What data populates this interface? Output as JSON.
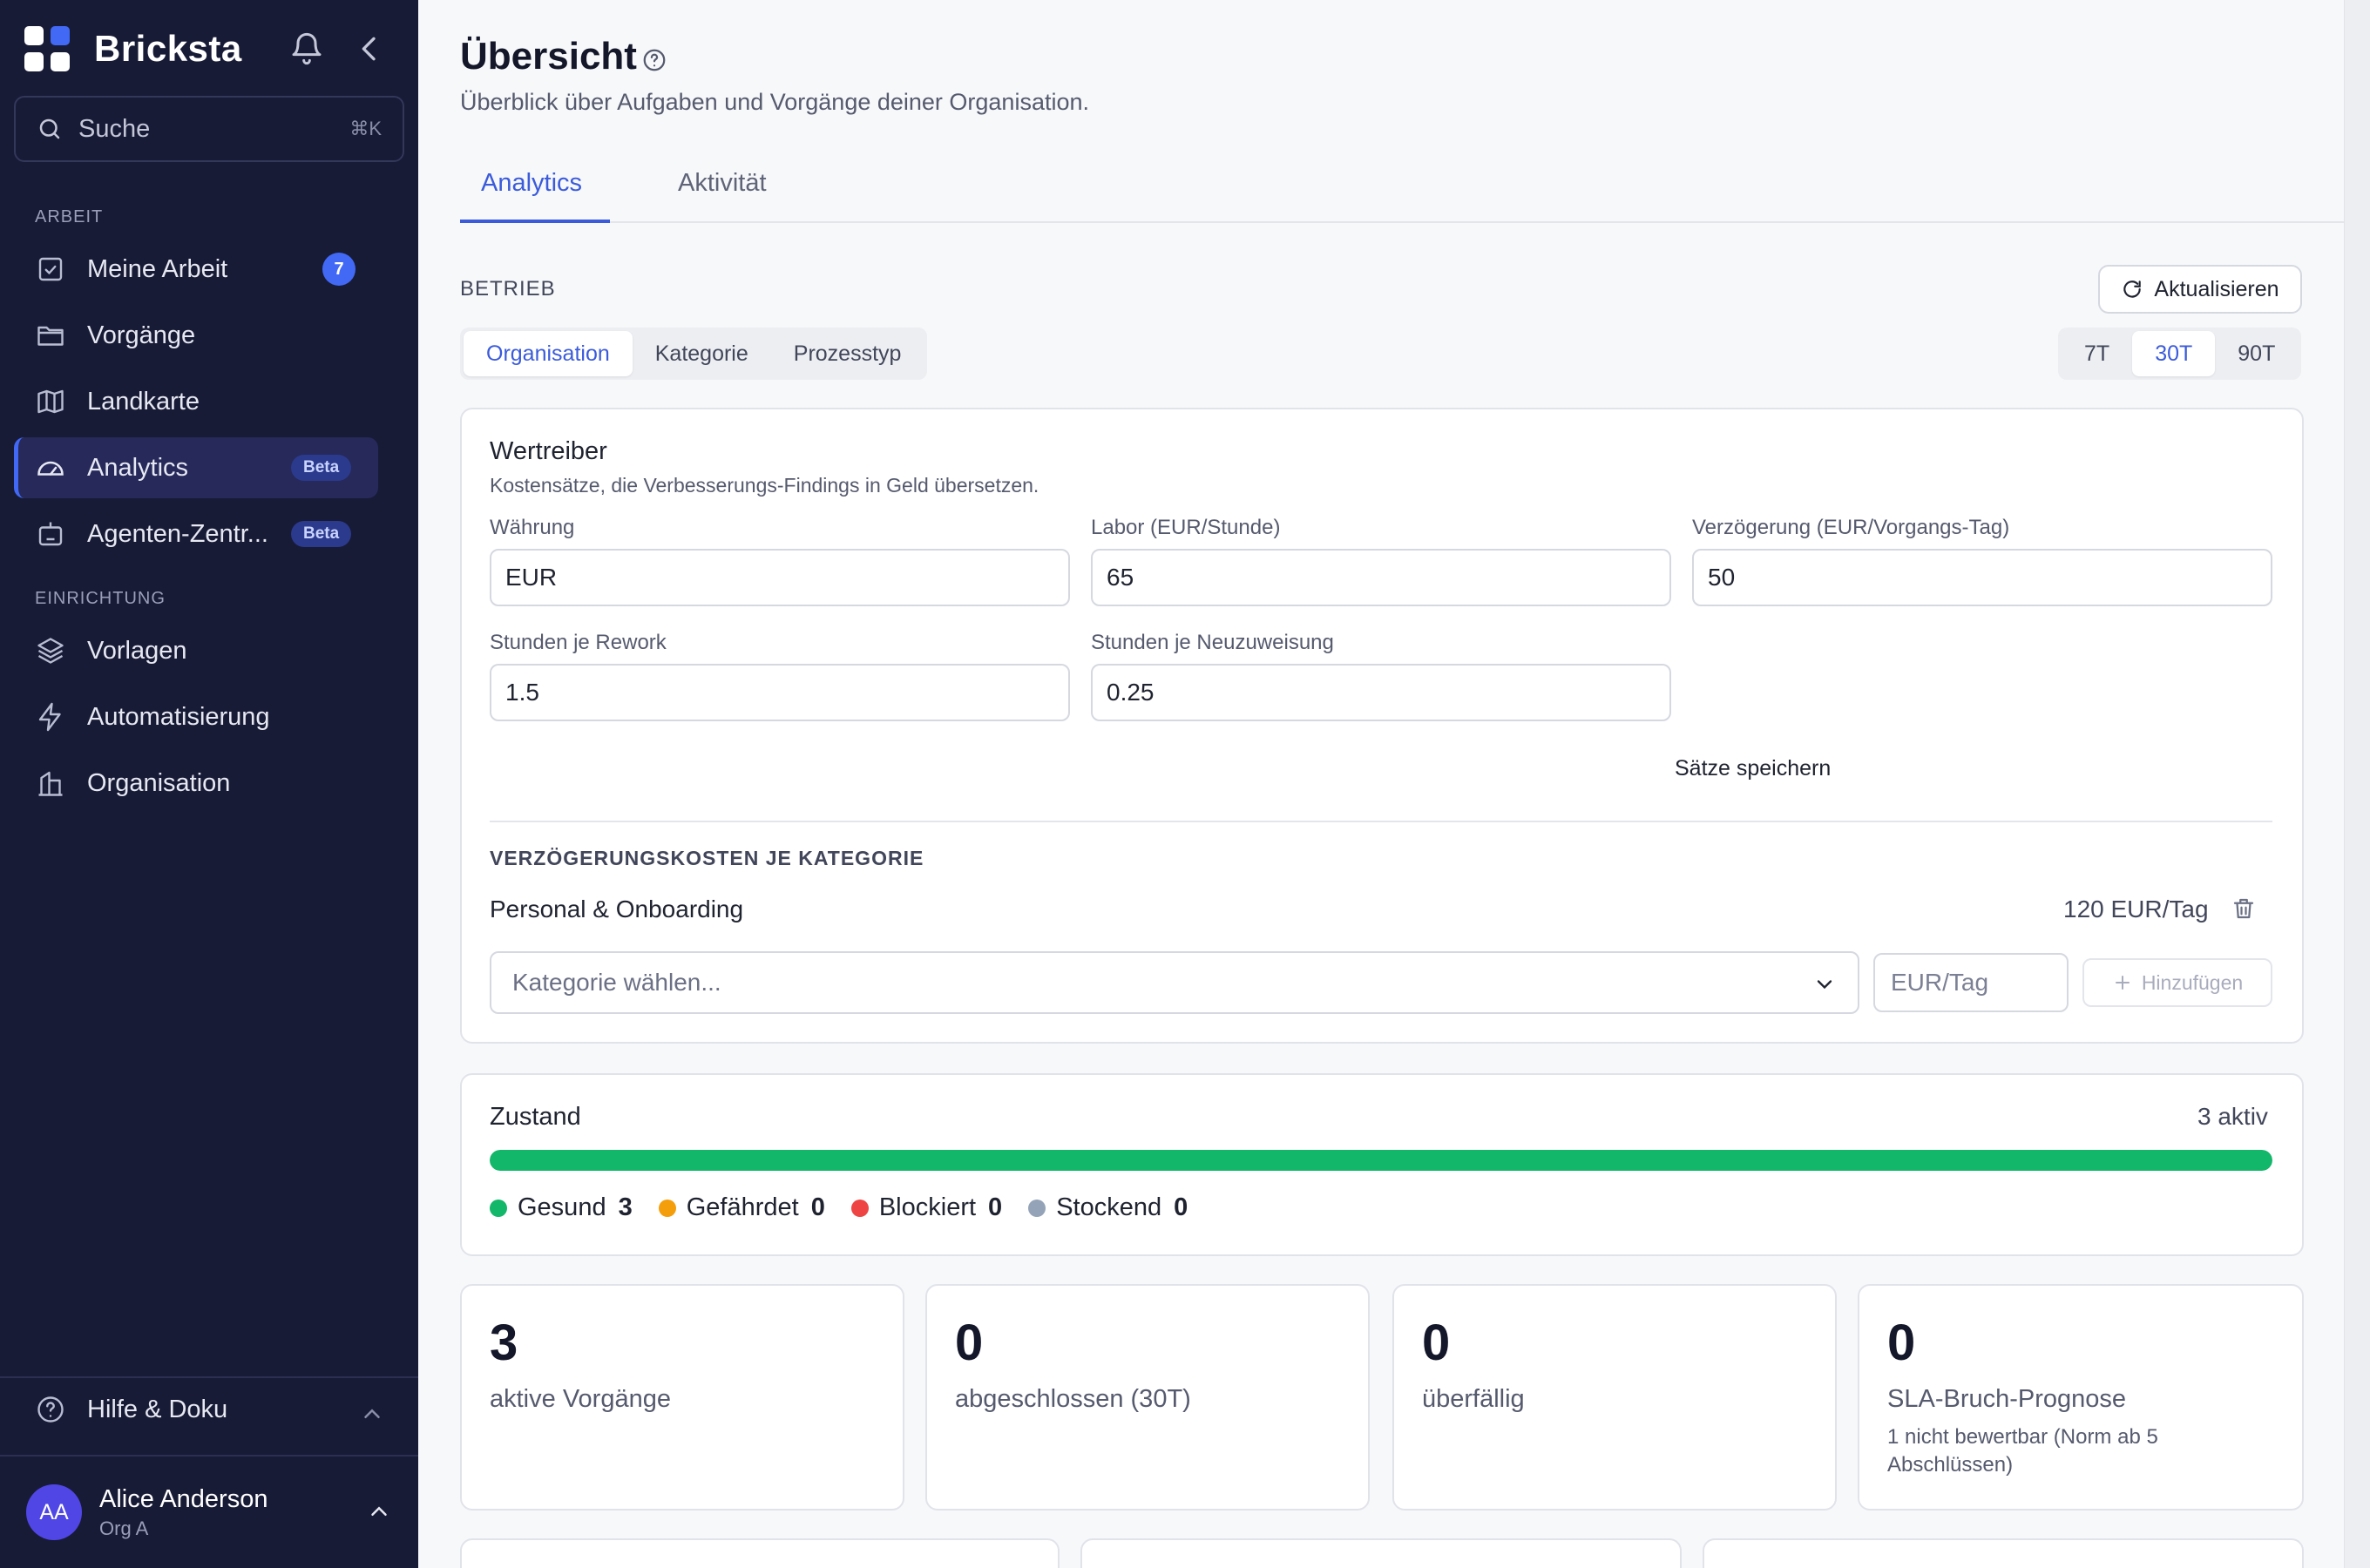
{
  "app": {
    "name": "Bricksta"
  },
  "search": {
    "label": "Suche",
    "shortcut": "⌘K"
  },
  "sidebar": {
    "section_work": "ARBEIT",
    "section_setup": "EINRICHTUNG",
    "items": [
      {
        "label": "Meine Arbeit",
        "count": "7",
        "icon": "checkbox-icon"
      },
      {
        "label": "Vorgänge",
        "icon": "folder-icon"
      },
      {
        "label": "Landkarte",
        "icon": "map-icon"
      },
      {
        "label": "Analytics",
        "badge": "Beta",
        "icon": "gauge-icon",
        "active": true
      },
      {
        "label": "Agenten-Zentr...",
        "badge": "Beta",
        "icon": "robot-icon"
      },
      {
        "label": "Vorlagen",
        "icon": "layers-icon"
      },
      {
        "label": "Automatisierung",
        "icon": "bolt-icon"
      },
      {
        "label": "Organisation",
        "icon": "building-icon"
      }
    ],
    "help": "Hilfe & Doku",
    "user": {
      "initials": "AA",
      "name": "Alice Anderson",
      "org": "Org A"
    }
  },
  "header": {
    "title": "Übersicht",
    "subtitle": "Überblick über Aufgaben und Vorgänge deiner Organisation."
  },
  "tabs": [
    {
      "label": "Analytics",
      "active": true
    },
    {
      "label": "Aktivität"
    }
  ],
  "betrieb": {
    "label": "BETRIEB",
    "refresh": "Aktualisieren",
    "scope": [
      "Organisation",
      "Kategorie",
      "Prozesstyp"
    ],
    "scope_selected": "Organisation",
    "range": [
      "7T",
      "30T",
      "90T"
    ],
    "range_selected": "30T"
  },
  "wertreiber": {
    "title": "Wertreiber",
    "subtitle": "Kostensätze, die Verbesserungs-Findings in Geld übersetzen.",
    "fields": {
      "currency": {
        "label": "Währung",
        "value": "EUR"
      },
      "labor": {
        "label": "Labor (EUR/Stunde)",
        "value": "65"
      },
      "delay": {
        "label": "Verzögerung (EUR/Vorgangs-Tag)",
        "value": "50"
      },
      "rework": {
        "label": "Stunden je Rework",
        "value": "1.5"
      },
      "reassign": {
        "label": "Stunden je Neuzuweisung",
        "value": "0.25"
      }
    },
    "save": "Sätze speichern",
    "category_section": "VERZÖGERUNGSKOSTEN JE KATEGORIE",
    "category": {
      "name": "Personal & Onboarding",
      "cost": "120 EUR/Tag"
    },
    "select_placeholder": "Kategorie wählen...",
    "eur_placeholder": "EUR/Tag",
    "add": "Hinzufügen"
  },
  "zustand": {
    "title": "Zustand",
    "active": "3 aktiv",
    "healthy_fraction": 1.0,
    "colors": {
      "healthy": "#12b76a",
      "risk": "#f59e0b",
      "blocked": "#ef4444",
      "stalled": "#94a3b8"
    },
    "legend": [
      {
        "label": "Gesund",
        "value": "3"
      },
      {
        "label": "Gefährdet",
        "value": "0"
      },
      {
        "label": "Blockiert",
        "value": "0"
      },
      {
        "label": "Stockend",
        "value": "0"
      }
    ]
  },
  "stats": [
    {
      "value": "3",
      "label": "aktive Vorgänge"
    },
    {
      "value": "0",
      "label": "abgeschlossen (30T)"
    },
    {
      "value": "0",
      "label": "überfällig"
    },
    {
      "value": "0",
      "label": "SLA-Bruch-Prognose",
      "note": "1 nicht bewertbar (Norm ab 5 Abschlüssen)"
    }
  ]
}
